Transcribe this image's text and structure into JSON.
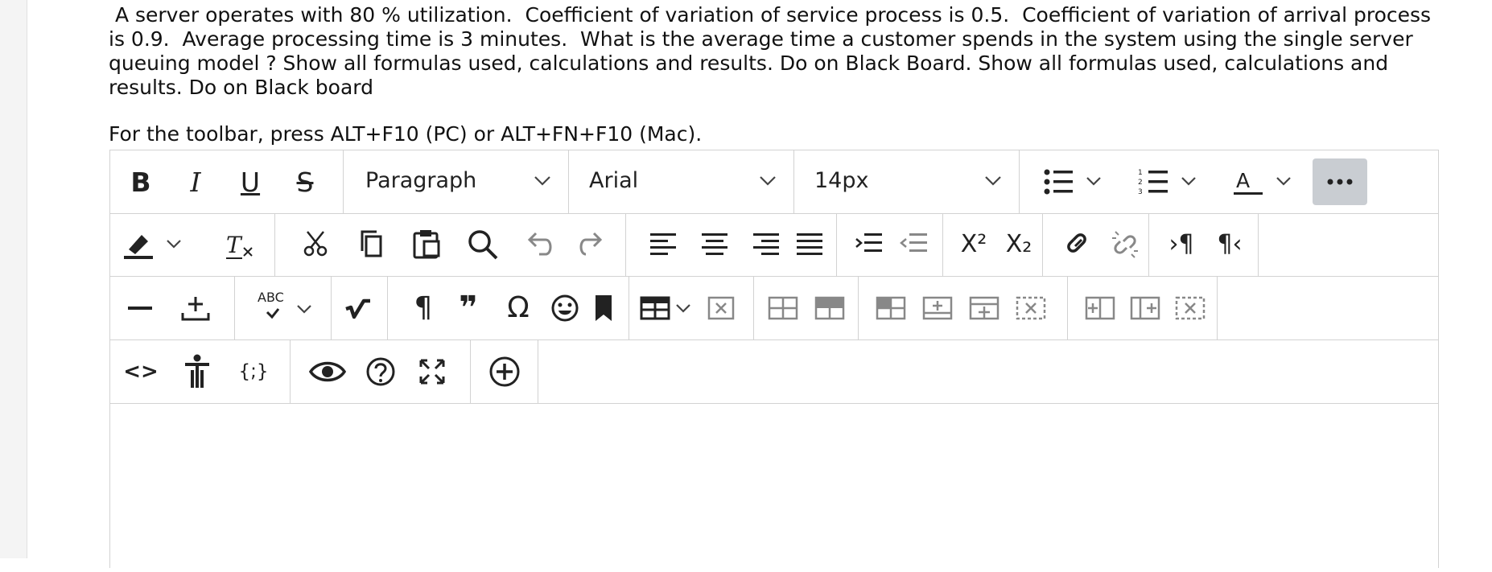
{
  "question": {
    "text": " A server operates with 80 % utilization.  Coefficient of variation of service process is 0.5.  Coefficient of variation of arrival process is 0.9.  Average processing time is 3 minutes.  What is the average time a customer spends in the system using the single server queuing model ? Show all formulas used, calculations and results. Do on Black Board. Show all formulas used, calculations and results. Do on Black board"
  },
  "editor": {
    "toolbar_hint": "For the toolbar, press ALT+F10 (PC) or ALT+FN+F10 (Mac).",
    "block_format": "Paragraph",
    "font_family": "Arial",
    "font_size": "14px",
    "glyphs": {
      "bold": "B",
      "italic": "I",
      "underline": "U",
      "strikethrough": "S",
      "superscript": "X²",
      "subscript": "X₂",
      "paragraph_mark": "¶",
      "quote": "❞",
      "omega": "Ω",
      "spellcheck": "ABC",
      "source_code": "<>",
      "variables": "{;}"
    }
  }
}
